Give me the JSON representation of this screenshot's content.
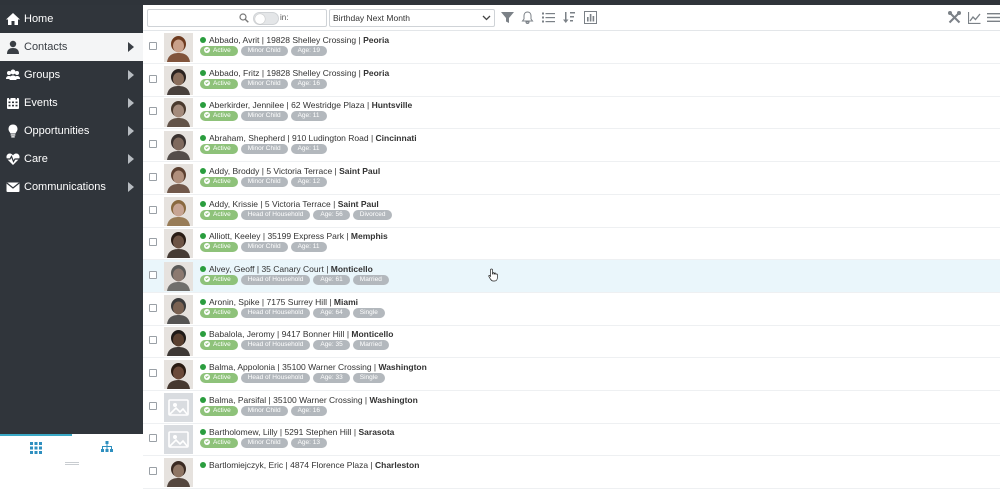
{
  "nav": {
    "items": [
      {
        "label": "Home",
        "icon": "home-icon",
        "active": false,
        "chevron": false
      },
      {
        "label": "Contacts",
        "icon": "person-icon",
        "active": true,
        "chevron": true
      },
      {
        "label": "Groups",
        "icon": "users-icon",
        "active": false,
        "chevron": true
      },
      {
        "label": "Events",
        "icon": "calendar-icon",
        "active": false,
        "chevron": true
      },
      {
        "label": "Opportunities",
        "icon": "lightbulb-icon",
        "active": false,
        "chevron": true
      },
      {
        "label": "Care",
        "icon": "heartbeat-icon",
        "active": false,
        "chevron": true
      },
      {
        "label": "Communications",
        "icon": "envelope-icon",
        "active": false,
        "chevron": true
      }
    ]
  },
  "toolbar": {
    "toggle_label": "in:",
    "filter_value": "Birthday Next Month"
  },
  "colors": {
    "sidebar_bg": "#30353b",
    "active_badge": "#8ec27a",
    "status_dot": "#2a9d3e",
    "row_highlight": "#eaf6fb"
  },
  "contacts": [
    {
      "name": "Abbado, Avrit",
      "address": "19828 Shelley Crossing",
      "city": "Peoria",
      "tags": [
        "Active",
        "Minor Child",
        "Age: 19"
      ],
      "photo": "portrait"
    },
    {
      "name": "Abbado, Fritz",
      "address": "19828 Shelley Crossing",
      "city": "Peoria",
      "tags": [
        "Active",
        "Minor Child",
        "Age: 16"
      ],
      "photo": "portrait"
    },
    {
      "name": "Aberkirder, Jennilee",
      "address": "62 Westridge Plaza",
      "city": "Huntsville",
      "tags": [
        "Active",
        "Minor Child",
        "Age: 11"
      ],
      "photo": "portrait"
    },
    {
      "name": "Abraham, Shepherd",
      "address": "910 Ludington Road",
      "city": "Cincinnati",
      "tags": [
        "Active",
        "Minor Child",
        "Age: 11"
      ],
      "photo": "portrait"
    },
    {
      "name": "Addy, Broddy",
      "address": "5 Victoria Terrace",
      "city": "Saint Paul",
      "tags": [
        "Active",
        "Minor Child",
        "Age: 12"
      ],
      "photo": "portrait"
    },
    {
      "name": "Addy, Krissie",
      "address": "5 Victoria Terrace",
      "city": "Saint Paul",
      "tags": [
        "Active",
        "Head of Household",
        "Age: 56",
        "Divorced"
      ],
      "photo": "portrait"
    },
    {
      "name": "Alliott, Keeley",
      "address": "35199 Express Park",
      "city": "Memphis",
      "tags": [
        "Active",
        "Minor Child",
        "Age: 11"
      ],
      "photo": "portrait"
    },
    {
      "name": "Alvey, Geoff",
      "address": "35 Canary Court",
      "city": "Monticello",
      "tags": [
        "Active",
        "Head of Household",
        "Age: 61",
        "Married"
      ],
      "photo": "portrait"
    },
    {
      "name": "Aronin, Spike",
      "address": "7175 Surrey Hill",
      "city": "Miami",
      "tags": [
        "Active",
        "Head of Household",
        "Age: 64",
        "Single"
      ],
      "photo": "portrait"
    },
    {
      "name": "Babalola, Jeromy",
      "address": "9417 Bonner Hill",
      "city": "Monticello",
      "tags": [
        "Active",
        "Head of Household",
        "Age: 35",
        "Married"
      ],
      "photo": "portrait"
    },
    {
      "name": "Balma, Appolonia",
      "address": "35100 Warner Crossing",
      "city": "Washington",
      "tags": [
        "Active",
        "Head of Household",
        "Age: 33",
        "Single"
      ],
      "photo": "portrait"
    },
    {
      "name": "Balma, Parsifal",
      "address": "35100 Warner Crossing",
      "city": "Washington",
      "tags": [
        "Active",
        "Minor Child",
        "Age: 16"
      ],
      "photo": "placeholder"
    },
    {
      "name": "Bartholomew, Lilly",
      "address": "5291 Stephen Hill",
      "city": "Sarasota",
      "tags": [
        "Active",
        "Minor Child",
        "Age: 13"
      ],
      "photo": "placeholder"
    },
    {
      "name": "Bartlomiejczyk, Eric",
      "address": "4874 Florence Plaza",
      "city": "Charleston",
      "tags": [],
      "photo": "portrait"
    }
  ]
}
